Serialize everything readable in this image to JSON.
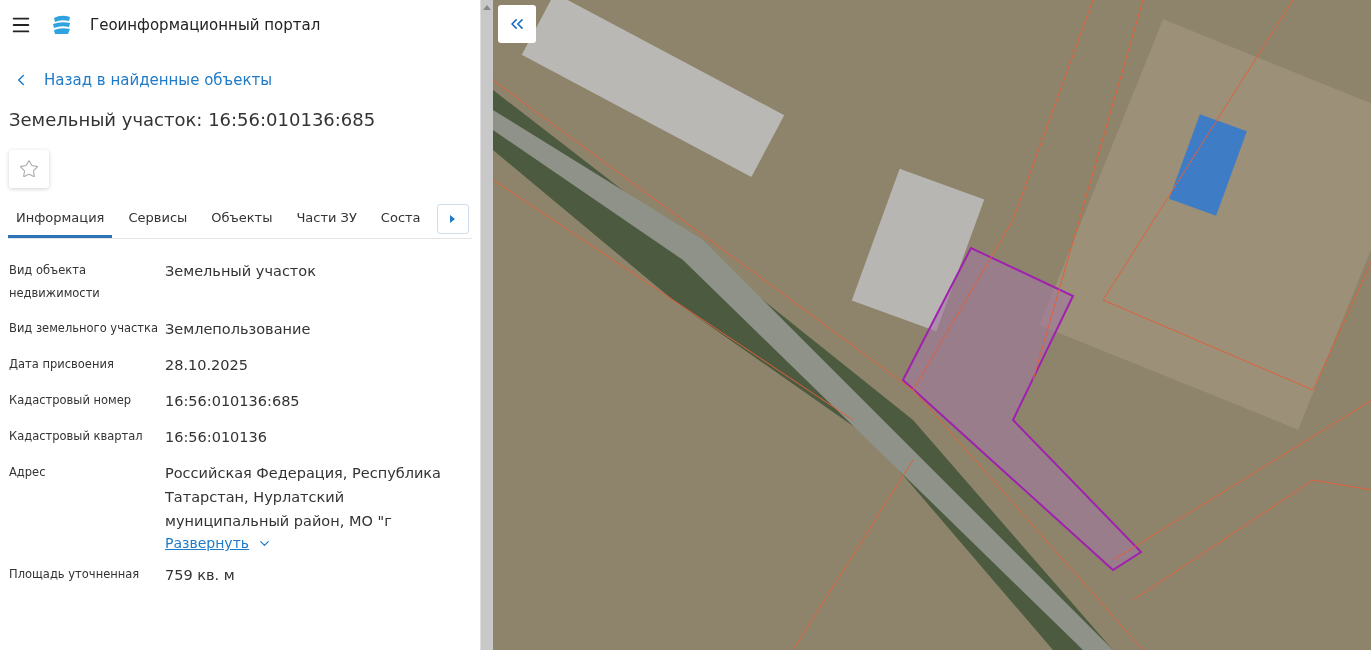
{
  "header": {
    "title": "Геоинформационный портал"
  },
  "back_link": "Назад в найденные объекты",
  "object_title": "Земельный участок: 16:56:010136:685",
  "favorite": {
    "on": false
  },
  "tabs": [
    {
      "label": "Информация",
      "selected": true
    },
    {
      "label": "Сервисы",
      "selected": false
    },
    {
      "label": "Объекты",
      "selected": false
    },
    {
      "label": "Части ЗУ",
      "selected": false
    },
    {
      "label": "Соста",
      "selected": false
    }
  ],
  "properties": [
    {
      "label": "Вид объекта недвижимости",
      "value": "Земельный участок"
    },
    {
      "label": "Вид земельного участка",
      "value": "Землепользование"
    },
    {
      "label": "Дата присвоения",
      "value": "28.10.2025"
    },
    {
      "label": "Кадастровый номер",
      "value": "16:56:010136:685"
    },
    {
      "label": "Кадастровый квартал",
      "value": "16:56:010136"
    },
    {
      "label": "Адрес",
      "value": "Российская Федерация, Республика Татарстан, Нурлатский муниципальный район, МО \"г",
      "expand_link": "Развернуть"
    },
    {
      "label": "Площадь уточненная",
      "value": "759 кв. м"
    }
  ]
}
